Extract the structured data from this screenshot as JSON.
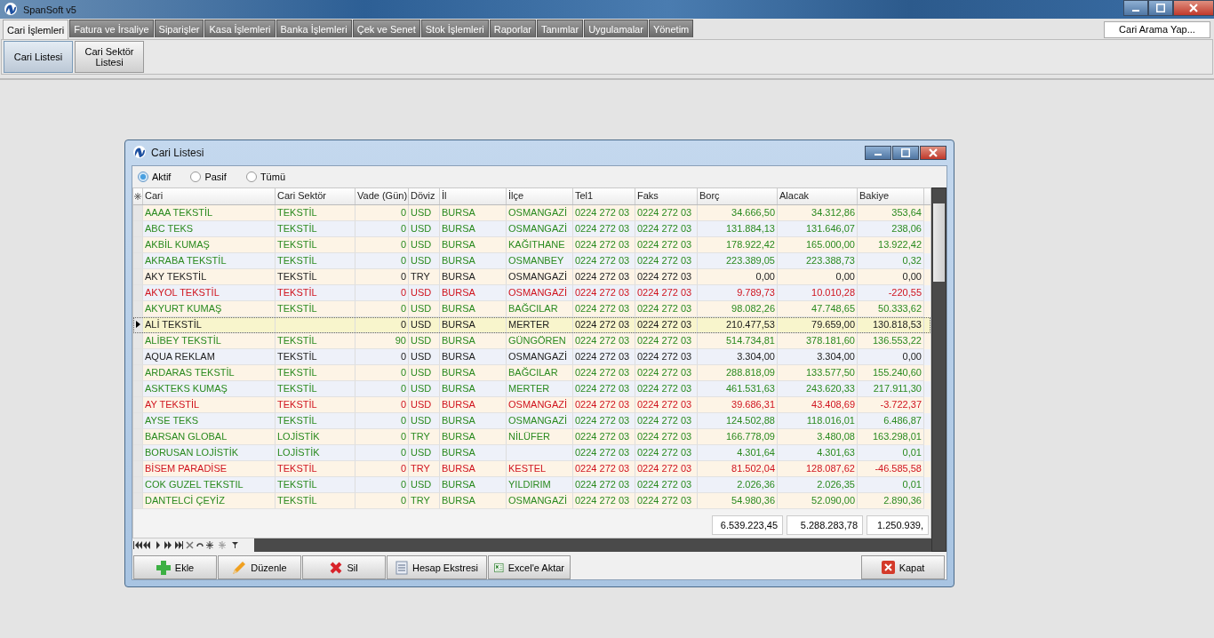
{
  "app": {
    "title": "SpanSoft v5"
  },
  "tabs": [
    {
      "label": "Cari İşlemleri",
      "selected": true
    },
    {
      "label": "Fatura ve İrsaliye",
      "selected": false
    },
    {
      "label": "Siparişler",
      "selected": false
    },
    {
      "label": "Kasa İşlemleri",
      "selected": false
    },
    {
      "label": "Banka İşlemleri",
      "selected": false
    },
    {
      "label": "Çek ve Senet",
      "selected": false
    },
    {
      "label": "Stok İşlemleri",
      "selected": false
    },
    {
      "label": "Raporlar",
      "selected": false
    },
    {
      "label": "Tanımlar",
      "selected": false
    },
    {
      "label": "Uygulamalar",
      "selected": false
    },
    {
      "label": "Yönetim",
      "selected": false
    }
  ],
  "search_button": "Cari Arama Yap...",
  "ribbon": [
    {
      "label": "Cari Listesi",
      "selected": true
    },
    {
      "label": "Cari Sektör Listesi",
      "selected": false
    }
  ],
  "dialog": {
    "title": "Cari Listesi",
    "filters": [
      {
        "label": "Aktif",
        "selected": true
      },
      {
        "label": "Pasif",
        "selected": false
      },
      {
        "label": "Tümü",
        "selected": false
      }
    ],
    "table": {
      "columns": [
        "Cari",
        "Cari Sektör",
        "Vade (Gün)",
        "Döviz",
        "İl",
        "İlçe",
        "Tel1",
        "Faks",
        "Borç",
        "Alacak",
        "Bakiye"
      ],
      "rows": [
        {
          "cells": [
            "AAAA TEKSTİL",
            "TEKSTİL",
            "0",
            "USD",
            "BURSA",
            "OSMANGAZİ",
            "0224 272 03",
            "0224 272 03",
            "34.666,50",
            "34.312,86",
            "353,64"
          ],
          "color": "#2a8a1f",
          "selected": false
        },
        {
          "cells": [
            "ABC TEKS",
            "TEKSTİL",
            "0",
            "USD",
            "BURSA",
            "OSMANGAZİ",
            "0224 272 03",
            "0224 272 03",
            "131.884,13",
            "131.646,07",
            "238,06"
          ],
          "color": "#2a8a1f",
          "selected": false
        },
        {
          "cells": [
            "AKBİL KUMAŞ",
            "TEKSTİL",
            "0",
            "USD",
            "BURSA",
            "KAĞITHANE",
            "0224 272 03",
            "0224 272 03",
            "178.922,42",
            "165.000,00",
            "13.922,42"
          ],
          "color": "#2a8a1f",
          "selected": false
        },
        {
          "cells": [
            "AKRABA TEKSTİL",
            "TEKSTİL",
            "0",
            "USD",
            "BURSA",
            "OSMANBEY",
            "0224 272 03",
            "0224 272 03",
            "223.389,05",
            "223.388,73",
            "0,32"
          ],
          "color": "#2a8a1f",
          "selected": false
        },
        {
          "cells": [
            "AKY TEKSTİL",
            "TEKSTİL",
            "0",
            "TRY",
            "BURSA",
            "OSMANGAZİ",
            "0224 272 03",
            "0224 272 03",
            "0,00",
            "0,00",
            "0,00"
          ],
          "color": "#222222",
          "selected": false
        },
        {
          "cells": [
            "AKYOL TEKSTİL",
            "TEKSTİL",
            "0",
            "USD",
            "BURSA",
            "OSMANGAZİ",
            "0224 272 03",
            "0224 272 03",
            "9.789,73",
            "10.010,28",
            "-220,55"
          ],
          "color": "#d0141e",
          "selected": false
        },
        {
          "cells": [
            "AKYURT KUMAŞ",
            "TEKSTİL",
            "0",
            "USD",
            "BURSA",
            "BAĞCILAR",
            "0224 272 03",
            "0224 272 03",
            "98.082,26",
            "47.748,65",
            "50.333,62"
          ],
          "color": "#2a8a1f",
          "selected": false
        },
        {
          "cells": [
            "ALİ TEKSTİL",
            null,
            "0",
            "USD",
            "BURSA",
            "MERTER",
            "0224 272 03",
            "0224 272 03",
            "210.477,53",
            "79.659,00",
            "130.818,53"
          ],
          "color": "#1a1a1a",
          "selected": true
        },
        {
          "cells": [
            "ALİBEY TEKSTİL",
            "TEKSTİL",
            "90",
            "USD",
            "BURSA",
            "GÜNGÖREN",
            "0224 272 03",
            "0224 272 03",
            "514.734,81",
            "378.181,60",
            "136.553,22"
          ],
          "color": "#2a8a1f",
          "selected": false
        },
        {
          "cells": [
            "AQUA REKLAM",
            "TEKSTİL",
            "0",
            "USD",
            "BURSA",
            "OSMANGAZİ",
            "0224 272 03",
            "0224 272 03",
            "3.304,00",
            "3.304,00",
            "0,00"
          ],
          "color": "#222222",
          "selected": false
        },
        {
          "cells": [
            "ARDARAS TEKSTİL",
            "TEKSTİL",
            "0",
            "USD",
            "BURSA",
            "BAĞCILAR",
            "0224 272 03",
            "0224 272 03",
            "288.818,09",
            "133.577,50",
            "155.240,60"
          ],
          "color": "#2a8a1f",
          "selected": false
        },
        {
          "cells": [
            "ASKTEKS KUMAŞ",
            "TEKSTİL",
            "0",
            "USD",
            "BURSA",
            "MERTER",
            "0224 272 03",
            "0224 272 03",
            "461.531,63",
            "243.620,33",
            "217.911,30"
          ],
          "color": "#2a8a1f",
          "selected": false
        },
        {
          "cells": [
            "AY TEKSTİL",
            "TEKSTİL",
            "0",
            "USD",
            "BURSA",
            "OSMANGAZİ",
            "0224 272 03",
            "0224 272 03",
            "39.686,31",
            "43.408,69",
            "-3.722,37"
          ],
          "color": "#d0141e",
          "selected": false
        },
        {
          "cells": [
            "AYSE TEKS",
            "TEKSTİL",
            "0",
            "USD",
            "BURSA",
            "OSMANGAZİ",
            "0224 272 03",
            "0224 272 03",
            "124.502,88",
            "118.016,01",
            "6.486,87"
          ],
          "color": "#2a8a1f",
          "selected": false
        },
        {
          "cells": [
            "BARSAN GLOBAL",
            "LOJİSTİK",
            "0",
            "TRY",
            "BURSA",
            "NİLÜFER",
            "0224 272 03",
            "0224 272 03",
            "166.778,09",
            "3.480,08",
            "163.298,01"
          ],
          "color": "#2a8a1f",
          "selected": false
        },
        {
          "cells": [
            "BORUSAN LOJİSTİK",
            "LOJİSTİK",
            "0",
            "USD",
            "BURSA",
            null,
            "0224 272 03",
            "0224 272 03",
            "4.301,64",
            "4.301,63",
            "0,01"
          ],
          "color": "#2a8a1f",
          "selected": false
        },
        {
          "cells": [
            "BİSEM PARADİSE",
            "TEKSTİL",
            "0",
            "TRY",
            "BURSA",
            "KESTEL",
            "0224 272 03",
            "0224 272 03",
            "81.502,04",
            "128.087,62",
            "-46.585,58"
          ],
          "color": "#d0141e",
          "selected": false
        },
        {
          "cells": [
            "COK GUZEL TEKSTIL",
            "TEKSTİL",
            "0",
            "USD",
            "BURSA",
            "YILDIRIM",
            "0224 272 03",
            "0224 272 03",
            "2.026,36",
            "2.026,35",
            "0,01"
          ],
          "color": "#2a8a1f",
          "selected": false
        },
        {
          "cells": [
            "DANTELCİ ÇEYİZ",
            "TEKSTİL",
            "0",
            "TRY",
            "BURSA",
            "OSMANGAZİ",
            "0224 272 03",
            "0224 272 03",
            "54.980,36",
            "52.090,00",
            "2.890,36"
          ],
          "color": "#2a8a1f",
          "selected": false
        }
      ],
      "totals": [
        "6.539.223,45",
        "5.288.283,78",
        "1.250.939,"
      ]
    },
    "buttons": [
      "Ekle",
      "Düzenle",
      "Sil",
      "Hesap Ekstresi",
      "Excel'e Aktar"
    ],
    "close_button": "Kapat"
  }
}
